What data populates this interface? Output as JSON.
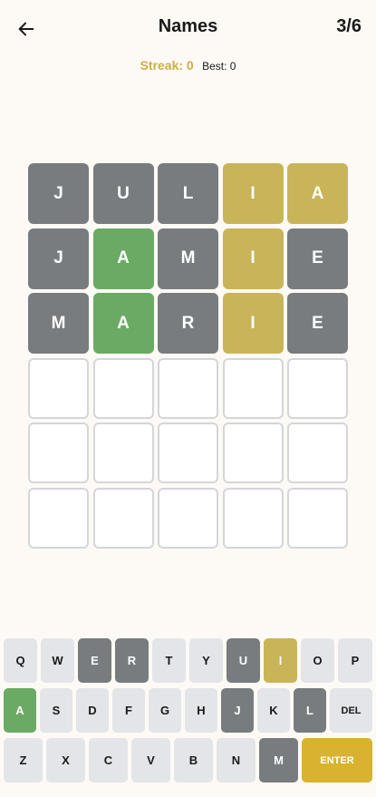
{
  "header": {
    "title": "Names",
    "attempts": "3/6"
  },
  "stats": {
    "streak": "Streak: 0",
    "best": "Best: 0"
  },
  "colors": {
    "correct": "#6aaa64",
    "present": "#c9b458",
    "absent": "#787c7e",
    "enter": "#d9b230",
    "streak": "#c9b045"
  },
  "board": [
    [
      {
        "letter": "J",
        "state": "gray"
      },
      {
        "letter": "U",
        "state": "gray"
      },
      {
        "letter": "L",
        "state": "gray"
      },
      {
        "letter": "I",
        "state": "yellow"
      },
      {
        "letter": "A",
        "state": "yellow"
      }
    ],
    [
      {
        "letter": "J",
        "state": "gray"
      },
      {
        "letter": "A",
        "state": "green"
      },
      {
        "letter": "M",
        "state": "gray"
      },
      {
        "letter": "I",
        "state": "yellow"
      },
      {
        "letter": "E",
        "state": "gray"
      }
    ],
    [
      {
        "letter": "M",
        "state": "gray"
      },
      {
        "letter": "A",
        "state": "green"
      },
      {
        "letter": "R",
        "state": "gray"
      },
      {
        "letter": "I",
        "state": "yellow"
      },
      {
        "letter": "E",
        "state": "gray"
      }
    ],
    [
      {
        "letter": "",
        "state": "empty"
      },
      {
        "letter": "",
        "state": "empty"
      },
      {
        "letter": "",
        "state": "empty"
      },
      {
        "letter": "",
        "state": "empty"
      },
      {
        "letter": "",
        "state": "empty"
      }
    ],
    [
      {
        "letter": "",
        "state": "empty"
      },
      {
        "letter": "",
        "state": "empty"
      },
      {
        "letter": "",
        "state": "empty"
      },
      {
        "letter": "",
        "state": "empty"
      },
      {
        "letter": "",
        "state": "empty"
      }
    ],
    [
      {
        "letter": "",
        "state": "empty"
      },
      {
        "letter": "",
        "state": "empty"
      },
      {
        "letter": "",
        "state": "empty"
      },
      {
        "letter": "",
        "state": "empty"
      },
      {
        "letter": "",
        "state": "empty"
      }
    ]
  ],
  "keyboard": [
    [
      {
        "label": "Q",
        "state": "default"
      },
      {
        "label": "W",
        "state": "default"
      },
      {
        "label": "E",
        "state": "gray"
      },
      {
        "label": "R",
        "state": "gray"
      },
      {
        "label": "T",
        "state": "default"
      },
      {
        "label": "Y",
        "state": "default"
      },
      {
        "label": "U",
        "state": "gray"
      },
      {
        "label": "I",
        "state": "yellow"
      },
      {
        "label": "O",
        "state": "default"
      },
      {
        "label": "P",
        "state": "default"
      }
    ],
    [
      {
        "label": "A",
        "state": "green"
      },
      {
        "label": "S",
        "state": "default"
      },
      {
        "label": "D",
        "state": "default"
      },
      {
        "label": "F",
        "state": "default"
      },
      {
        "label": "G",
        "state": "default"
      },
      {
        "label": "H",
        "state": "default"
      },
      {
        "label": "J",
        "state": "gray"
      },
      {
        "label": "K",
        "state": "default"
      },
      {
        "label": "L",
        "state": "gray"
      },
      {
        "label": "DEL",
        "state": "default"
      }
    ],
    [
      {
        "label": "Z",
        "state": "default"
      },
      {
        "label": "X",
        "state": "default"
      },
      {
        "label": "C",
        "state": "default"
      },
      {
        "label": "V",
        "state": "default"
      },
      {
        "label": "B",
        "state": "default"
      },
      {
        "label": "N",
        "state": "default"
      },
      {
        "label": "M",
        "state": "gray"
      },
      {
        "label": "ENTER",
        "state": "enter"
      }
    ]
  ]
}
